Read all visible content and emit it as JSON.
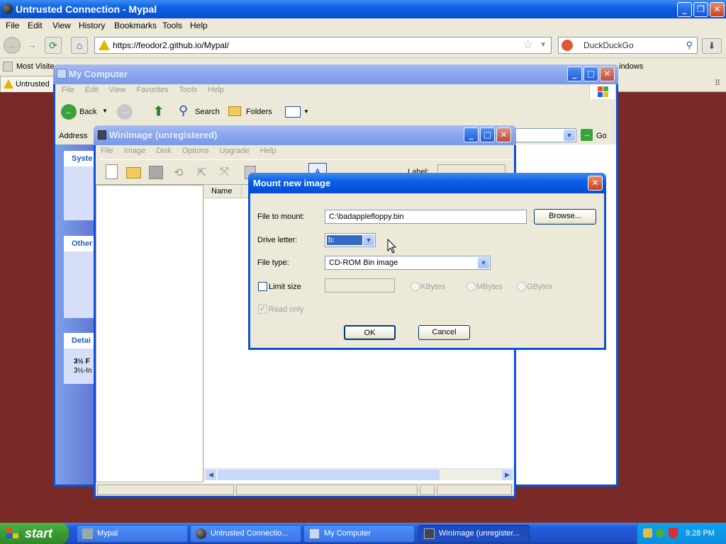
{
  "browser": {
    "title": "Untrusted Connection - Mypal",
    "menu": [
      "File",
      "Edit",
      "View",
      "History",
      "Bookmarks",
      "Tools",
      "Help"
    ],
    "url": "https://feodor2.github.io/Mypal/",
    "search_placeholder": "DuckDuckGo",
    "bookmark_first": "Most Visite",
    "bookmark_last": "indows",
    "tab_label": "Untrusted"
  },
  "mycomputer": {
    "title": "My Computer",
    "menu": [
      "File",
      "Edit",
      "View",
      "Favorites",
      "Tools",
      "Help"
    ],
    "toolbar": {
      "back": "Back",
      "search": "Search",
      "folders": "Folders"
    },
    "address_label": "Address",
    "go_label": "Go",
    "panels": {
      "system": "Syste",
      "other": "Other",
      "details": "Detai",
      "details_line1": "3½ F",
      "details_line2": "3½-In"
    }
  },
  "winimage": {
    "title": "WinImage (unregistered)",
    "menu": [
      "File",
      "Image",
      "Disk",
      "Options",
      "Upgrade",
      "Help"
    ],
    "label_text": "Label:",
    "column_name": "Name"
  },
  "dialog": {
    "title": "Mount new image",
    "file_to_mount_label": "File to mount:",
    "file_to_mount_value": "C:\\badapplefloppy.bin",
    "browse_label": "Browse...",
    "drive_letter_label": "Drive letter:",
    "drive_letter_value": "b:",
    "file_type_label": "File type:",
    "file_type_value": "CD-ROM Bin image",
    "limit_size_label": "Limit size",
    "kbytes_label": "KBytes",
    "mbytes_label": "MBytes",
    "gbytes_label": "GBytes",
    "read_only_label": "Read only",
    "ok_label": "OK",
    "cancel_label": "Cancel"
  },
  "taskbar": {
    "start": "start",
    "tasks": [
      "Mypal",
      "Untrusted Connectio...",
      "My Computer",
      "WinImage (unregister..."
    ],
    "clock": "9:28 PM"
  }
}
